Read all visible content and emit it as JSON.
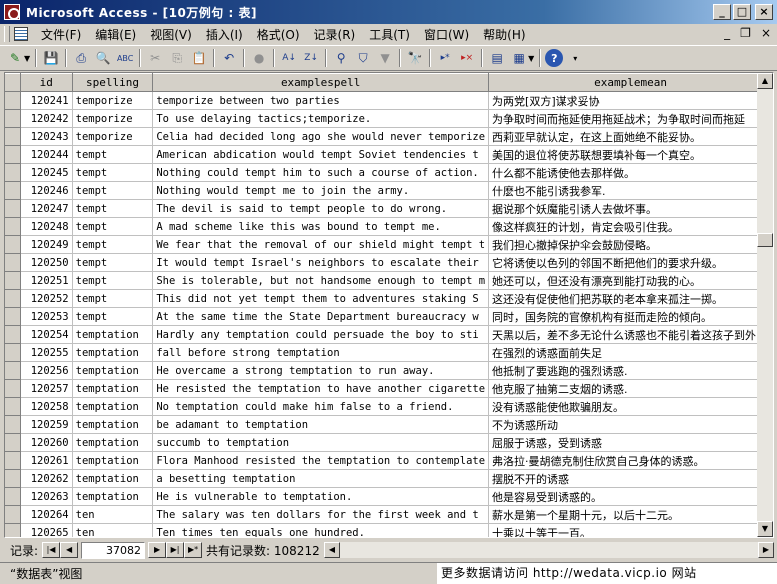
{
  "window": {
    "title": "Microsoft Access - [10万例句 : 表]",
    "minimize": "_",
    "maximize": "□",
    "close": "×"
  },
  "menubar": {
    "items": [
      "文件(F)",
      "编辑(E)",
      "视图(V)",
      "插入(I)",
      "格式(O)",
      "记录(R)",
      "工具(T)",
      "窗口(W)",
      "帮助(H)"
    ],
    "doc_controls": [
      "_",
      "❐",
      "×"
    ]
  },
  "toolbar": {
    "icons": [
      {
        "name": "view-icon",
        "glyph": "✎"
      },
      {
        "name": "save-icon",
        "glyph": "💾"
      },
      {
        "name": "print-icon",
        "glyph": "⎙"
      },
      {
        "name": "print-preview-icon",
        "glyph": "🔍"
      },
      {
        "name": "spelling-icon",
        "glyph": "ABC"
      },
      {
        "name": "cut-icon",
        "glyph": "✂"
      },
      {
        "name": "copy-icon",
        "glyph": "⎘"
      },
      {
        "name": "paste-icon",
        "glyph": "📋"
      },
      {
        "name": "undo-icon",
        "glyph": "↶"
      },
      {
        "name": "insert-object-icon",
        "glyph": "●"
      },
      {
        "name": "sort-ascending-icon",
        "glyph": "A↓"
      },
      {
        "name": "sort-descending-icon",
        "glyph": "Z↓"
      },
      {
        "name": "filter-by-selection-icon",
        "glyph": "⚲"
      },
      {
        "name": "filter-by-form-icon",
        "glyph": "⛉"
      },
      {
        "name": "apply-filter-icon",
        "glyph": "▼"
      },
      {
        "name": "find-icon",
        "glyph": "🔭"
      },
      {
        "name": "new-record-icon",
        "glyph": "▸*"
      },
      {
        "name": "delete-record-icon",
        "glyph": "▸×"
      },
      {
        "name": "database-window-icon",
        "glyph": "▤"
      },
      {
        "name": "new-object-icon",
        "glyph": "▦"
      },
      {
        "name": "help-icon",
        "glyph": "?"
      }
    ]
  },
  "table": {
    "columns": [
      "id",
      "spelling",
      "examplespell",
      "examplemean"
    ],
    "rows": [
      [
        "120241",
        "temporize",
        "temporize between two parties",
        "为两党[双方]谋求妥协"
      ],
      [
        "120242",
        "temporize",
        "To use delaying tactics;temporize.",
        "为争取时间而拖延使用拖延战术；为争取时间而拖延"
      ],
      [
        "120243",
        "temporize",
        "Celia had decided long ago she would never temporize",
        "西莉亚早就认定，在这上面她绝不能妥协。"
      ],
      [
        "120244",
        "tempt",
        "American abdication would tempt Soviet tendencies t",
        "美国的退位将使苏联想要填补每一个真空。"
      ],
      [
        "120245",
        "tempt",
        "Nothing could tempt him to such a course of action.",
        "什么都不能诱使他去那样做。"
      ],
      [
        "120246",
        "tempt",
        "Nothing would tempt me to join the army.",
        "什麽也不能引诱我参军."
      ],
      [
        "120247",
        "tempt",
        "The devil is said to tempt people to do wrong.",
        "据说那个妖魔能引诱人去做坏事。"
      ],
      [
        "120248",
        "tempt",
        "A mad scheme like this was bound to tempt me.",
        "像这样疯狂的计划，肯定会吸引住我。"
      ],
      [
        "120249",
        "tempt",
        "We fear that the removal of our shield might tempt t",
        "我们担心撤掉保护伞会鼓励侵略。"
      ],
      [
        "120250",
        "tempt",
        "It would tempt Israel's neighbors to escalate their",
        "它将诱使以色列的邻国不断把他们的要求升级。"
      ],
      [
        "120251",
        "tempt",
        "She is tolerable, but not handsome enough to tempt m",
        "她还可以，但还没有漂亮到能打动我的心。"
      ],
      [
        "120252",
        "tempt",
        "This did not yet tempt them to adventures staking S",
        "这还没有促使他们把苏联的老本拿来孤注一掷。"
      ],
      [
        "120253",
        "tempt",
        "At the same time the State Department bureaucracy w",
        "同时，国务院的官僚机构有挺而走险的倾向。"
      ],
      [
        "120254",
        "temptation",
        "Hardly any temptation could persuade the boy to sti",
        "天黑以后，差不多无论什么诱惑也不能引着这孩子到外"
      ],
      [
        "120255",
        "temptation",
        "fall before strong temptation",
        "在强烈的诱惑面前失足"
      ],
      [
        "120256",
        "temptation",
        "He overcame a strong temptation to run away.",
        "他抵制了要逃跑的强烈诱惑."
      ],
      [
        "120257",
        "temptation",
        "He resisted the temptation to have another cigarette",
        "他克服了抽第二支烟的诱惑."
      ],
      [
        "120258",
        "temptation",
        "No temptation could make him false to a friend.",
        "没有诱惑能使他欺骗朋友。"
      ],
      [
        "120259",
        "temptation",
        "be adamant to temptation",
        "不为诱惑所动"
      ],
      [
        "120260",
        "temptation",
        "succumb to temptation",
        "屈服于诱惑，受到诱惑"
      ],
      [
        "120261",
        "temptation",
        "Flora Manhood resisted the temptation to contemplate",
        "弗洛拉·曼胡德克制住欣赏自己身体的诱惑。"
      ],
      [
        "120262",
        "temptation",
        "a besetting temptation",
        "摆脱不开的诱惑"
      ],
      [
        "120263",
        "temptation",
        "He is vulnerable to temptation.",
        "他是容易受到诱惑的。"
      ],
      [
        "120264",
        "ten",
        "The salary was ten dollars for the first week and t",
        "薪水是第一个星期十元，以后十二元。"
      ],
      [
        "120265",
        "ten",
        "Ten times ten equals one hundred.",
        "十乘以十等于一百。"
      ]
    ]
  },
  "record_nav": {
    "label": "记录:",
    "current": "37082",
    "total_text": "共有记录数: 108212",
    "first": "|◀",
    "prev": "◀",
    "next": "▶",
    "last": "▶|",
    "new": "▶*"
  },
  "statusbar": {
    "view_text": "“数据表”视图",
    "watermark": "更多数据请访问 http://wedata.vicp.io 网站"
  }
}
